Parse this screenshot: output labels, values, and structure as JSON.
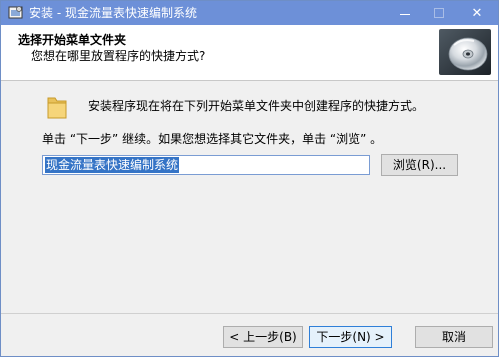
{
  "window": {
    "title": "安装 - 现金流量表快速编制系统",
    "minimize_icon": "minimize-icon",
    "maximize_icon": "maximize-icon",
    "close_icon": "close-icon",
    "close_glyph": "✕",
    "title_bar_color": "#6d90d8"
  },
  "header": {
    "title": "选择开始菜单文件夹",
    "subtitle": "您想在哪里放置程序的快捷方式?",
    "image_icon": "cd-disc-icon"
  },
  "body": {
    "folder_icon": "folder-icon",
    "info": "安装程序现在将在下列开始菜单文件夹中创建程序的快捷方式。",
    "instruction": "单击 “下一步” 继续。如果您想选择其它文件夹，单击 “浏览” 。",
    "folder_value": "现金流量表快速编制系统",
    "browse_label": "浏览(R)..."
  },
  "footer": {
    "back_label": "< 上一步(B)",
    "next_label": "下一步(N) >",
    "cancel_label": "取消"
  }
}
